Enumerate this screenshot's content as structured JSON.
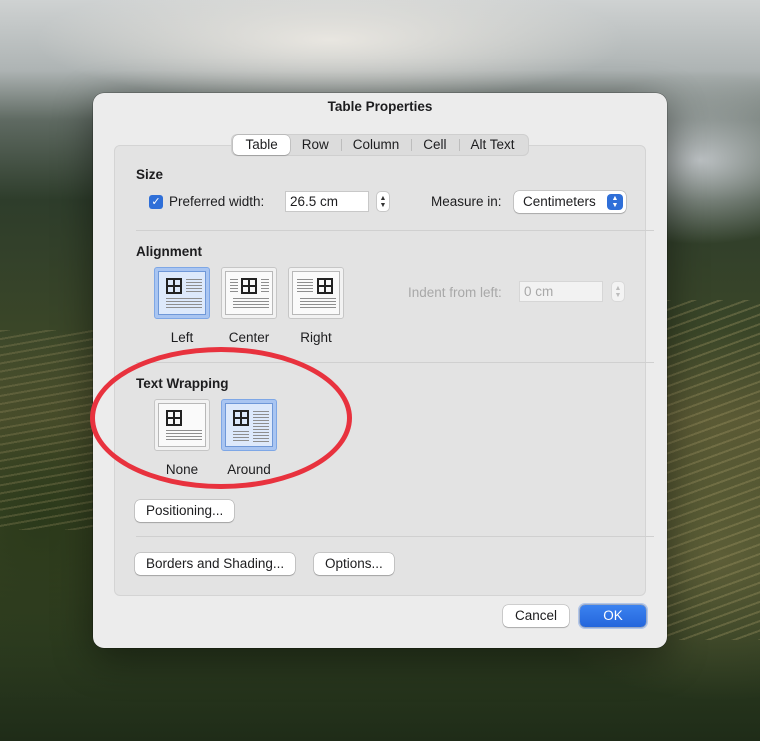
{
  "dialog": {
    "title": "Table Properties"
  },
  "tabs": [
    {
      "label": "Table",
      "active": true
    },
    {
      "label": "Row",
      "active": false
    },
    {
      "label": "Column",
      "active": false
    },
    {
      "label": "Cell",
      "active": false
    },
    {
      "label": "Alt Text",
      "active": false
    }
  ],
  "size": {
    "title": "Size",
    "preferred_width_label": "Preferred width:",
    "preferred_width_checked": true,
    "preferred_width_value": "26.5 cm",
    "measure_label": "Measure in:",
    "measure_value": "Centimeters"
  },
  "alignment": {
    "title": "Alignment",
    "options": [
      "Left",
      "Center",
      "Right"
    ],
    "selected": "Left",
    "indent_label": "Indent from left:",
    "indent_placeholder": "0 cm"
  },
  "text_wrapping": {
    "title": "Text Wrapping",
    "options": [
      "None",
      "Around"
    ],
    "selected": "Around"
  },
  "buttons": {
    "positioning": "Positioning...",
    "borders_shading": "Borders and Shading...",
    "options": "Options...",
    "cancel": "Cancel",
    "ok": "OK"
  },
  "colors": {
    "accent": "#2f6fd8",
    "selection": "#a9c5f1",
    "annotation_red": "#e8323e"
  },
  "icons": {
    "checkbox": "checkmark-icon",
    "stepper": "up-down-stepper-icon",
    "popup": "chevron-up-down-icon"
  }
}
